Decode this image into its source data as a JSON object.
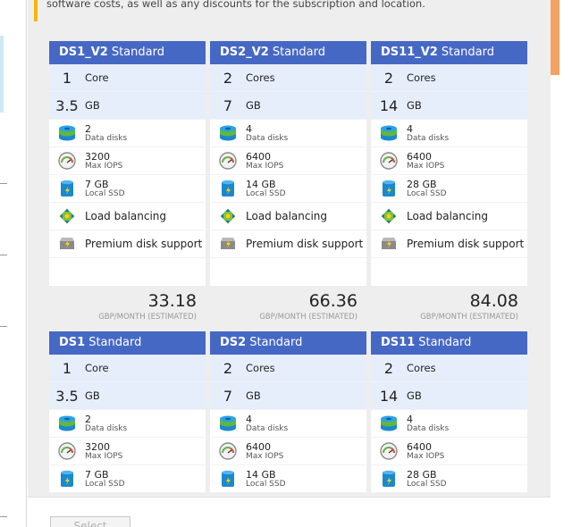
{
  "header": {
    "text": "software costs, as well as any discounts for the subscription and location."
  },
  "bottom": {
    "select_label": "Select"
  },
  "rows": [
    {
      "cards": [
        {
          "name": "DS1_V2",
          "tier": "Standard",
          "cores": {
            "num": "1",
            "unit": "Core"
          },
          "memory": {
            "num": "3.5",
            "unit": "GB"
          },
          "disks": {
            "val": "2",
            "sub": "Data disks"
          },
          "iops": {
            "val": "3200",
            "sub": "Max IOPS"
          },
          "ssd": {
            "val": "7 GB",
            "sub": "Local SSD"
          },
          "lb": "Load balancing",
          "premium": "Premium disk support",
          "price": "33.18",
          "per": "GBP/MONTH (ESTIMATED)"
        },
        {
          "name": "DS2_V2",
          "tier": "Standard",
          "cores": {
            "num": "2",
            "unit": "Cores"
          },
          "memory": {
            "num": "7",
            "unit": "GB"
          },
          "disks": {
            "val": "4",
            "sub": "Data disks"
          },
          "iops": {
            "val": "6400",
            "sub": "Max IOPS"
          },
          "ssd": {
            "val": "14 GB",
            "sub": "Local SSD"
          },
          "lb": "Load balancing",
          "premium": "Premium disk support",
          "price": "66.36",
          "per": "GBP/MONTH (ESTIMATED)"
        },
        {
          "name": "DS11_V2",
          "tier": "Standard",
          "cores": {
            "num": "2",
            "unit": "Cores"
          },
          "memory": {
            "num": "14",
            "unit": "GB"
          },
          "disks": {
            "val": "4",
            "sub": "Data disks"
          },
          "iops": {
            "val": "6400",
            "sub": "Max IOPS"
          },
          "ssd": {
            "val": "28 GB",
            "sub": "Local SSD"
          },
          "lb": "Load balancing",
          "premium": "Premium disk support",
          "price": "84.08",
          "per": "GBP/MONTH (ESTIMATED)"
        }
      ]
    },
    {
      "cards": [
        {
          "name": "DS1",
          "tier": "Standard",
          "cores": {
            "num": "1",
            "unit": "Core"
          },
          "memory": {
            "num": "3.5",
            "unit": "GB"
          },
          "disks": {
            "val": "2",
            "sub": "Data disks"
          },
          "iops": {
            "val": "3200",
            "sub": "Max IOPS"
          },
          "ssd": {
            "val": "7 GB",
            "sub": "Local SSD"
          }
        },
        {
          "name": "DS2",
          "tier": "Standard",
          "cores": {
            "num": "2",
            "unit": "Cores"
          },
          "memory": {
            "num": "7",
            "unit": "GB"
          },
          "disks": {
            "val": "4",
            "sub": "Data disks"
          },
          "iops": {
            "val": "6400",
            "sub": "Max IOPS"
          },
          "ssd": {
            "val": "14 GB",
            "sub": "Local SSD"
          }
        },
        {
          "name": "DS11",
          "tier": "Standard",
          "cores": {
            "num": "2",
            "unit": "Cores"
          },
          "memory": {
            "num": "14",
            "unit": "GB"
          },
          "disks": {
            "val": "4",
            "sub": "Data disks"
          },
          "iops": {
            "val": "6400",
            "sub": "Max IOPS"
          },
          "ssd": {
            "val": "28 GB",
            "sub": "Local SSD"
          }
        }
      ]
    }
  ],
  "icons": {
    "disks": "data-disks-icon",
    "iops": "max-iops-gauge-icon",
    "ssd": "local-ssd-icon",
    "lb": "load-balancing-icon",
    "premium": "premium-disk-icon"
  },
  "colors": {
    "card_header": "#4668c5",
    "spec_row": "#e6eefc",
    "blade_bg": "#eeeeee"
  }
}
